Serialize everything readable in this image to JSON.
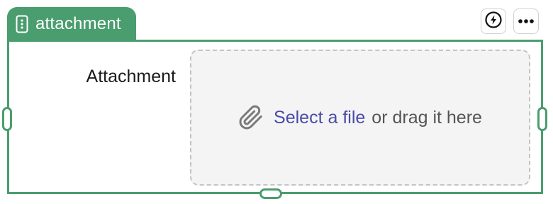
{
  "block": {
    "tab_label": "attachment",
    "tab_icon": "form-field-icon",
    "accent_color": "#4a9d6e"
  },
  "toolbar": {
    "action_icon": "lightning-bolt-icon",
    "more_icon": "more-horizontal-icon"
  },
  "field": {
    "label": "Attachment"
  },
  "dropzone": {
    "icon": "paperclip-icon",
    "select_link": "Select a file",
    "drag_text": "or drag it here"
  }
}
